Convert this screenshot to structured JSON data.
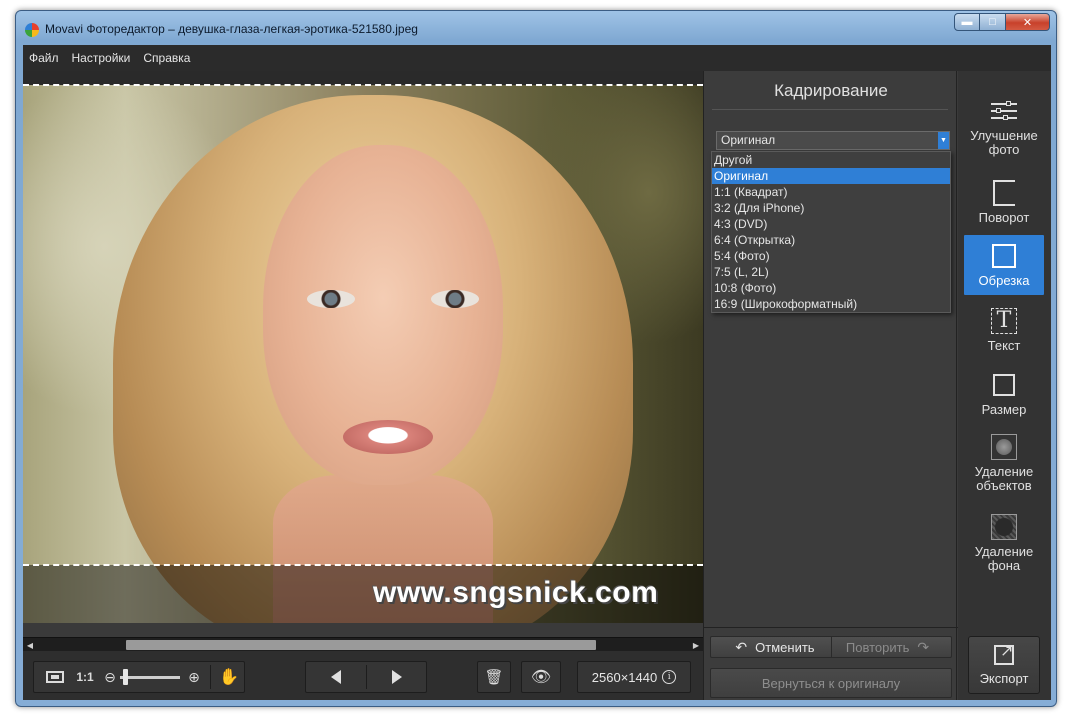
{
  "window": {
    "title": "Movavi Фоторедактор – девушка-глаза-легкая-эротика-521580.jpeg",
    "min_glyph": "▬",
    "max_glyph": "□",
    "close_glyph": "✕"
  },
  "menu": [
    {
      "label": "Файл"
    },
    {
      "label": "Настройки"
    },
    {
      "label": "Справка"
    }
  ],
  "canvas": {
    "watermark": "www.sngsnick.com"
  },
  "toolbar": {
    "zoom_label": "1:1",
    "zoom_level": 0.05,
    "image_size": "2560×1440",
    "info_glyph": "i"
  },
  "crop_panel": {
    "title": "Кадрирование",
    "selected": "Оригинал",
    "options": [
      "Другой",
      "Оригинал",
      "1:1 (Квадрат)",
      "3:2 (Для iPhone)",
      "4:3 (DVD)",
      "6:4 (Открытка)",
      "5:4 (Фото)",
      "7:5 (L, 2L)",
      "10:8 (Фото)",
      "16:9 (Широкоформатный)"
    ],
    "undo_label": "Отменить",
    "redo_label": "Повторить",
    "revert_label": "Вернуться к оригиналу"
  },
  "sidebar": {
    "items": [
      {
        "label": "Улучшение фото",
        "icon": "sliders-icon"
      },
      {
        "label": "Поворот",
        "icon": "rotate-icon"
      },
      {
        "label": "Обрезка",
        "icon": "crop-icon",
        "active": true
      },
      {
        "label": "Текст",
        "icon": "text-icon"
      },
      {
        "label": "Размер",
        "icon": "resize-icon"
      },
      {
        "label": "Удаление объектов",
        "icon": "object-removal-icon"
      },
      {
        "label": "Удаление фона",
        "icon": "background-removal-icon"
      }
    ],
    "export_label": "Экспорт"
  },
  "colors": {
    "accent": "#2f7fd6",
    "panel_bg": "#3c3c3c",
    "menubar_bg": "#2b2b2b"
  }
}
